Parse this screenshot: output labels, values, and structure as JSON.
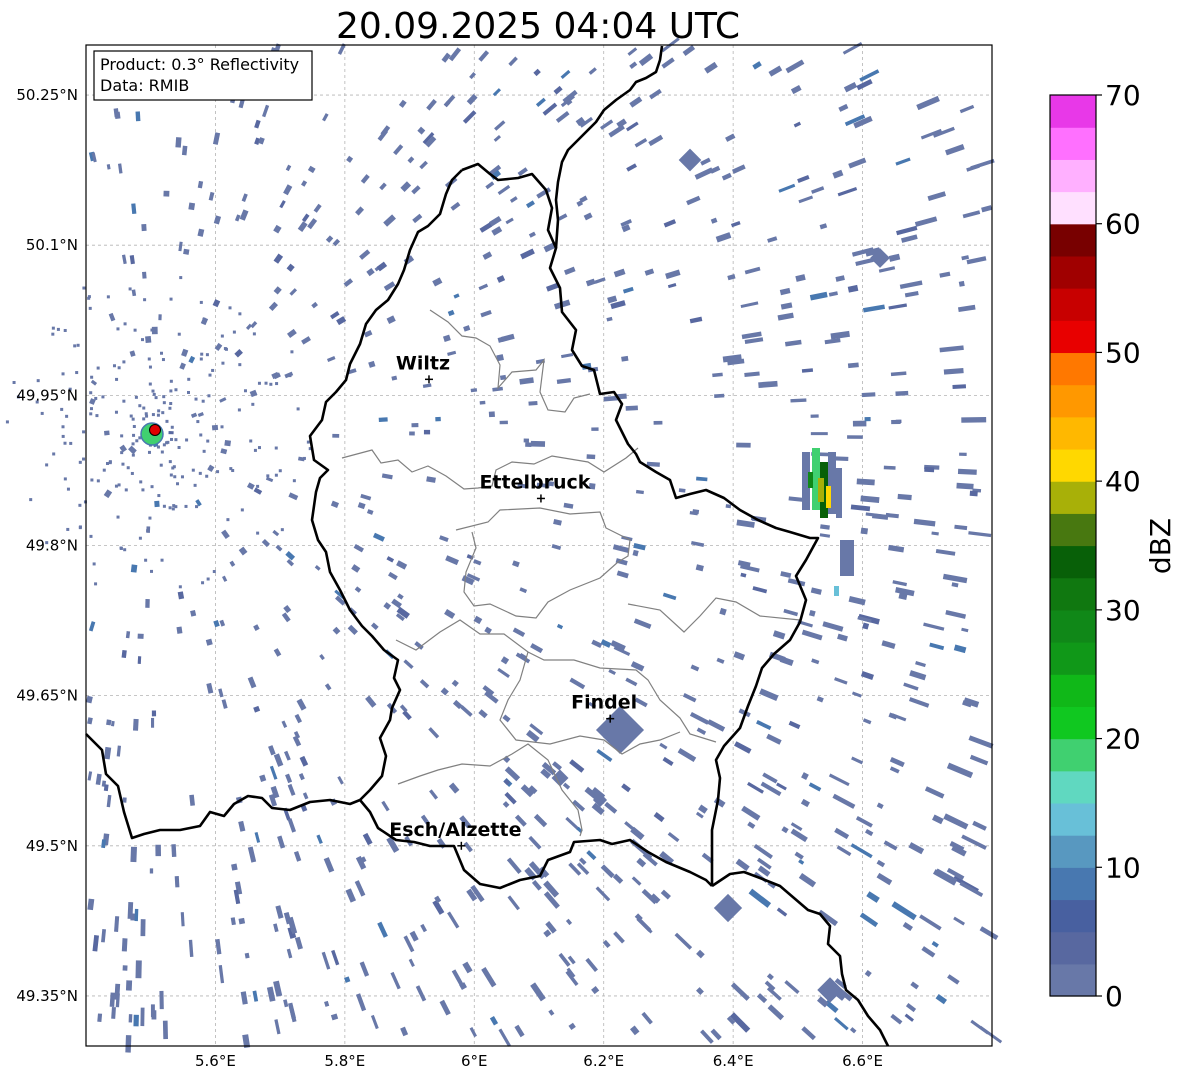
{
  "map": {
    "title": "20.09.2025 04:04 UTC",
    "info_box": {
      "line1": "Product: 0.3° Reflectivity",
      "line2": "Data: RMIB"
    },
    "lon_range": [
      5.4,
      6.8
    ],
    "lat_range": [
      49.3,
      50.3
    ],
    "lon_ticks": [
      {
        "value": 5.6,
        "label": "5.6°E"
      },
      {
        "value": 5.8,
        "label": "5.8°E"
      },
      {
        "value": 6.0,
        "label": "6°E"
      },
      {
        "value": 6.2,
        "label": "6.2°E"
      },
      {
        "value": 6.4,
        "label": "6.4°E"
      },
      {
        "value": 6.6,
        "label": "6.6°E"
      }
    ],
    "lat_ticks": [
      {
        "value": 50.25,
        "label": "50.25°N"
      },
      {
        "value": 50.1,
        "label": "50.1°N"
      },
      {
        "value": 49.95,
        "label": "49.95°N"
      },
      {
        "value": 49.8,
        "label": "49.8°N"
      },
      {
        "value": 49.65,
        "label": "49.65°N"
      },
      {
        "value": 49.5,
        "label": "49.5°N"
      },
      {
        "value": 49.35,
        "label": "49.35°N"
      }
    ],
    "cities": [
      {
        "name": "Wiltz",
        "lon": 5.93,
        "lat": 49.966
      },
      {
        "name": "Ettelbruck",
        "lon": 6.103,
        "lat": 49.847
      },
      {
        "name": "Findel",
        "lon": 6.21,
        "lat": 49.627
      },
      {
        "name": "Esch/Alzette",
        "lon": 5.98,
        "lat": 49.5
      }
    ],
    "radar_site": {
      "lon": 5.505,
      "lat": 49.915
    },
    "colorbar": {
      "label": "dBZ",
      "min": 0,
      "max": 70,
      "ticks": [
        {
          "value": 0,
          "label": "0"
        },
        {
          "value": 10,
          "label": "10"
        },
        {
          "value": 20,
          "label": "20"
        },
        {
          "value": 30,
          "label": "30"
        },
        {
          "value": 40,
          "label": "40"
        },
        {
          "value": 50,
          "label": "50"
        },
        {
          "value": 60,
          "label": "60"
        },
        {
          "value": 70,
          "label": "70"
        }
      ],
      "colors": [
        "#6878a8",
        "#5868a0",
        "#4860a0",
        "#4878b0",
        "#5898c0",
        "#68c0d8",
        "#60d8c0",
        "#40d070",
        "#10c820",
        "#10b818",
        "#109818",
        "#108818",
        "#107810",
        "#086008",
        "#487810",
        "#a8b008",
        "#ffd800",
        "#ffb800",
        "#ff9800",
        "#ff7800",
        "#e80000",
        "#c80000",
        "#a00000",
        "#780000",
        "#ffe0ff",
        "#ffb0ff",
        "#ff70ff",
        "#e838e8"
      ]
    },
    "colors": {
      "echo": "#6878a8",
      "border": "#000000",
      "district": "#808080",
      "grid": "#b4b4b4"
    }
  }
}
